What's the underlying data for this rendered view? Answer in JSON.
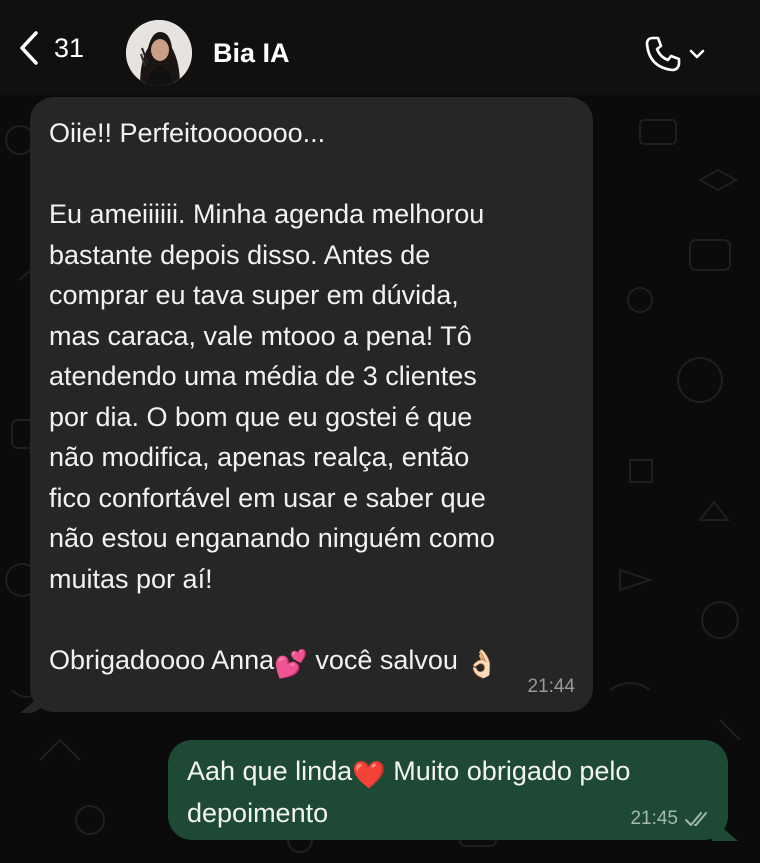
{
  "header": {
    "back_count": "31",
    "contact_name": "Bia IA"
  },
  "messages": [
    {
      "direction": "incoming",
      "paragraphs": [
        "Oiie!! Perfeitooooooo...",
        "Eu ameiiiiii. Minha agenda melhorou\nbastante depois disso. Antes de\ncomprar eu tava super em dúvida,\nmas caraca, vale mtooo a pena! Tô\natendendo uma média de 3 clientes\npor dia. O bom que eu gostei é que\nnão modifica, apenas realça, então\nfico confortável em usar e saber que\nnão estou enganando ninguém como\nmuitas por aí!"
      ],
      "closing_a": "Obrigadoooo Anna",
      "closing_emoji_1": "💕",
      "closing_b": " você salvou ",
      "closing_emoji_2": "👌🏻",
      "time": "21:44"
    },
    {
      "direction": "outgoing",
      "text_a": "Aah que linda",
      "emoji": "❤️",
      "text_b": " Muito obrigado pelo\ndepoimento",
      "time": "21:45",
      "status_icon": "double-check-icon"
    }
  ],
  "colors": {
    "background": "#0b0b0b",
    "incoming_bubble": "#262626",
    "outgoing_bubble": "#1e4a35"
  }
}
